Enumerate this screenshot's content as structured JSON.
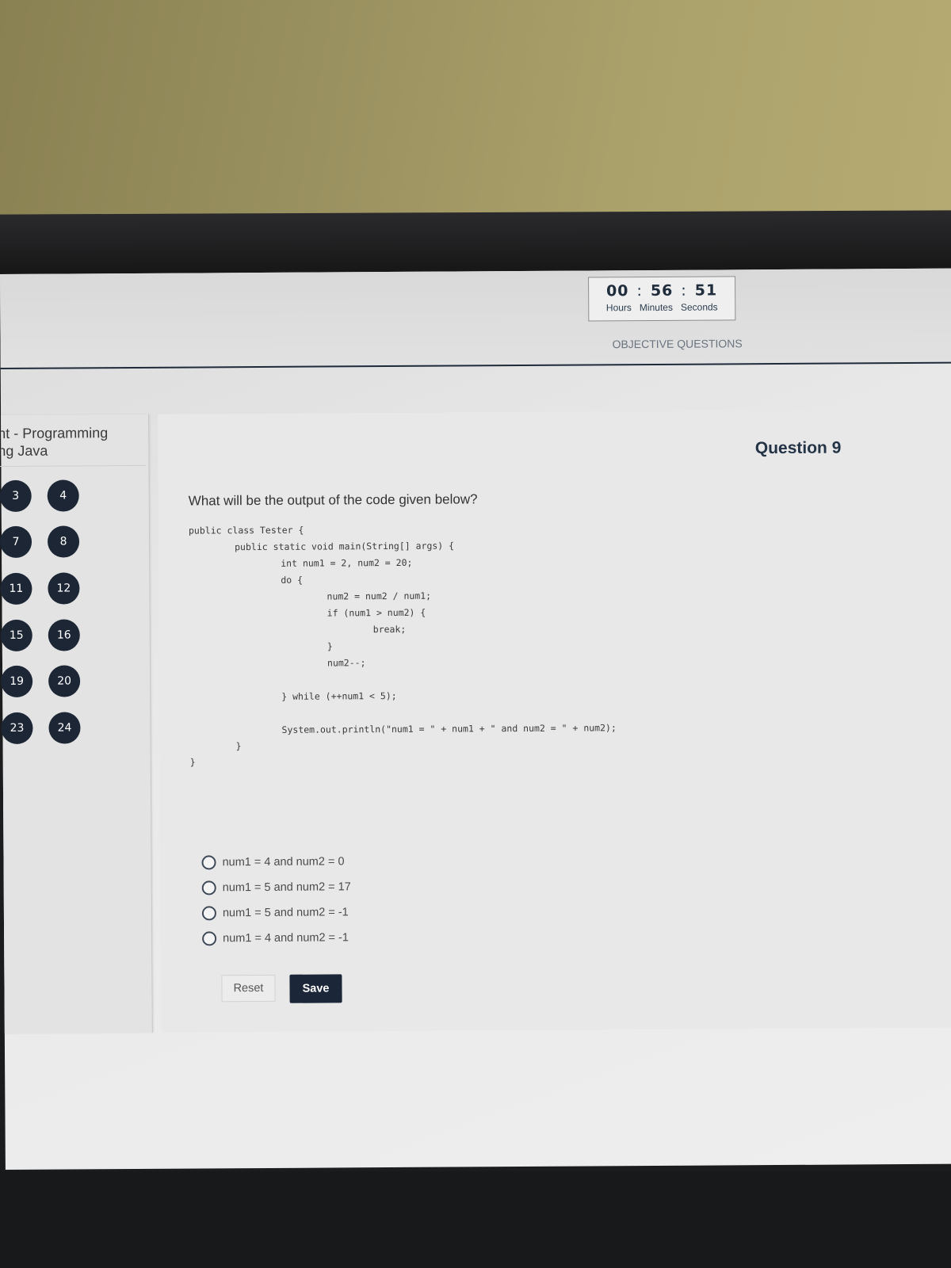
{
  "timer": {
    "hours": "00",
    "minutes": "56",
    "seconds": "51",
    "hours_label": "Hours",
    "minutes_label": "Minutes",
    "seconds_label": "Seconds"
  },
  "header": {
    "tab_label": "OBJECTIVE QUESTIONS"
  },
  "sidebar": {
    "title_line1": "nt - Programming",
    "title_line2": "ng Java",
    "question_numbers": [
      "3",
      "4",
      "7",
      "8",
      "11",
      "12",
      "15",
      "16",
      "19",
      "20",
      "23",
      "24"
    ]
  },
  "question": {
    "label": "Question 9",
    "prompt": "What will be the output of the code given below?",
    "code": [
      "public class Tester {",
      "public static void main(String[] args) {",
      "int num1 = 2, num2 = 20;",
      "do {",
      "num2 = num2 / num1;",
      "if (num1 > num2) {",
      "break;",
      "}",
      "num2--;",
      "} while (++num1 < 5);",
      "System.out.println(\"num1 = \" + num1 + \" and num2 = \" + num2);",
      "}",
      "}"
    ],
    "options": [
      "num1 = 4 and num2 = 0",
      "num1 = 5 and num2 = 17",
      "num1 = 5 and num2 = -1",
      "num1 = 4 and num2 = -1"
    ]
  },
  "actions": {
    "reset_label": "Reset",
    "save_label": "Save"
  },
  "colors": {
    "navy": "#1c2635",
    "screen_bg": "#e8e8e8"
  }
}
